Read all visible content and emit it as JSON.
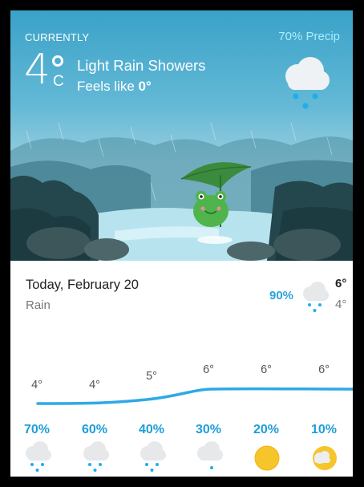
{
  "current": {
    "label": "CURRENTLY",
    "precip": "70% Precip",
    "temperature": "4",
    "unit": "C",
    "condition": "Light Rain Showers",
    "feels_like_prefix": "Feels like ",
    "feels_like_value": "0°",
    "icon": "rain-cloud-icon"
  },
  "today": {
    "title": "Today, February 20",
    "condition": "Rain",
    "precip": "90%",
    "high": "6°",
    "low": "4°",
    "icon": "rain-cloud-icon"
  },
  "hourly": [
    {
      "temp": "4°",
      "precip": "70%",
      "icon": "rain-cloud-icon"
    },
    {
      "temp": "4°",
      "precip": "60%",
      "icon": "rain-cloud-icon"
    },
    {
      "temp": "5°",
      "precip": "40%",
      "icon": "rain-cloud-icon"
    },
    {
      "temp": "6°",
      "precip": "30%",
      "icon": "rain-cloud-icon"
    },
    {
      "temp": "6°",
      "precip": "20%",
      "icon": "sun-icon"
    },
    {
      "temp": "6°",
      "precip": "10%",
      "icon": "partly-cloudy-icon"
    }
  ],
  "colors": {
    "accent": "#1e9ed8",
    "precip_top": "#a9eefc",
    "curve": "#2ea9e6",
    "sun": "#f6c52b"
  }
}
